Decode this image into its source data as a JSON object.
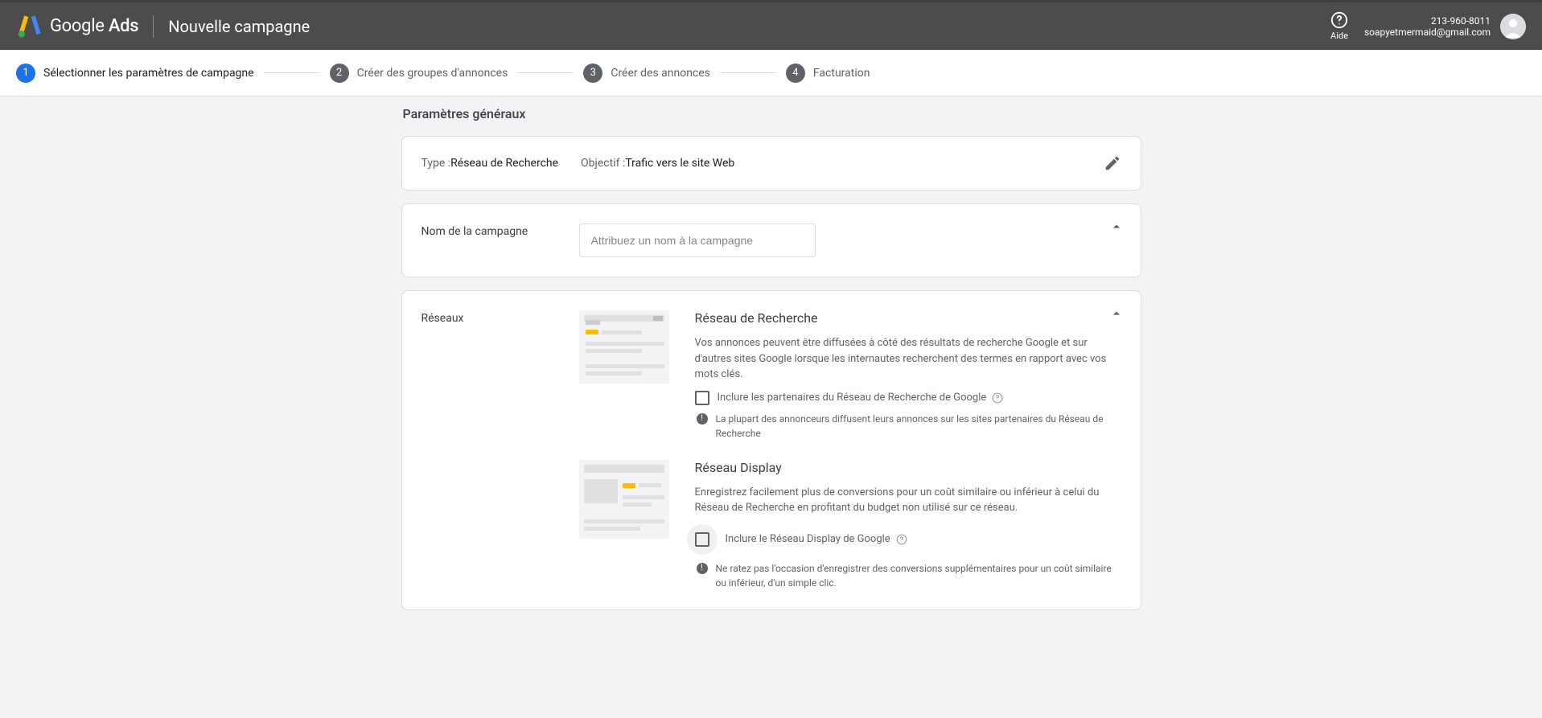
{
  "brand": {
    "name": "Google Ads"
  },
  "page_title": "Nouvelle campagne",
  "help": {
    "label": "Aide"
  },
  "user": {
    "phone": "213-960-8011",
    "email": "soapyetmermaid@gmail.com"
  },
  "steps": [
    {
      "num": "1",
      "label": "Sélectionner les paramètres de campagne"
    },
    {
      "num": "2",
      "label": "Créer des groupes d'annonces"
    },
    {
      "num": "3",
      "label": "Créer des annonces"
    },
    {
      "num": "4",
      "label": "Facturation"
    }
  ],
  "section": {
    "heading": "Paramètres généraux"
  },
  "summary": {
    "type_label": "Type : ",
    "type_value": "Réseau de Recherche",
    "obj_label": "Objectif : ",
    "obj_value": "Trafic vers le site Web"
  },
  "campaign_name": {
    "label": "Nom de la campagne",
    "placeholder": "Attribuez un nom à la campagne"
  },
  "networks": {
    "label": "Réseaux",
    "search": {
      "title": "Réseau de Recherche",
      "desc": "Vos annonces peuvent être diffusées à côté des résultats de recherche Google et sur d'autres sites Google lorsque les internautes recherchent des termes en rapport avec vos mots clés.",
      "checkbox": "Inclure les partenaires du Réseau de Recherche de Google",
      "hint": "La plupart des annonceurs diffusent leurs annonces sur les sites partenaires du Réseau de Recherche"
    },
    "display": {
      "title": "Réseau Display",
      "desc": "Enregistrez facilement plus de conversions pour un coût similaire ou inférieur à celui du Réseau de Recherche en profitant du budget non utilisé sur ce réseau.",
      "checkbox": "Inclure le Réseau Display de Google",
      "hint": "Ne ratez pas l'occasion d'enregistrer des conversions supplémentaires pour un coût similaire ou inférieur, d'un simple clic."
    }
  }
}
